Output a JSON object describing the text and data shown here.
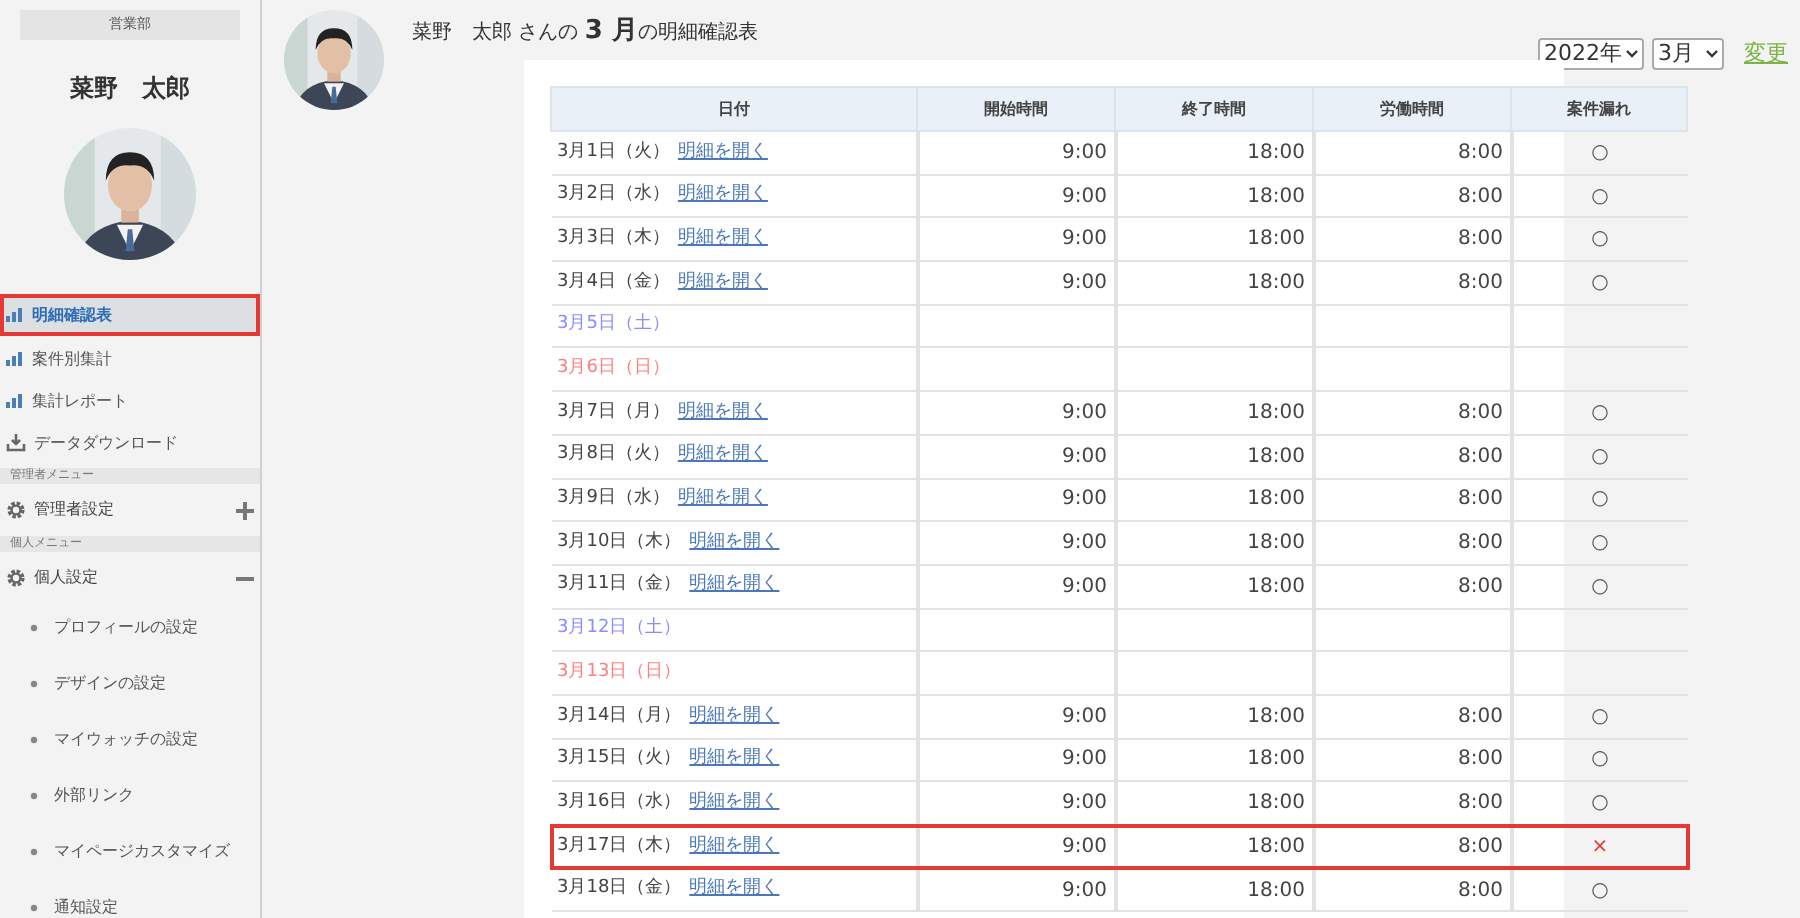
{
  "sidebar": {
    "department": "営業部",
    "user_name": "菜野　太郎",
    "menu": [
      {
        "kind": "report",
        "label": "明細確認表",
        "selected": true
      },
      {
        "kind": "report",
        "label": "案件別集計",
        "selected": false
      },
      {
        "kind": "report",
        "label": "集計レポート",
        "selected": false
      },
      {
        "kind": "download",
        "label": "データダウンロード",
        "selected": false
      },
      {
        "kind": "section",
        "label": "管理者メニュー"
      },
      {
        "kind": "group",
        "label": "管理者設定",
        "expanded": false
      },
      {
        "kind": "section",
        "label": "個人メニュー"
      },
      {
        "kind": "group",
        "label": "個人設定",
        "expanded": true,
        "children": [
          {
            "label": "プロフィールの設定"
          },
          {
            "label": "デザインの設定"
          },
          {
            "label": "マイウォッチの設定"
          },
          {
            "label": "外部リンク"
          },
          {
            "label": "マイページカスタマイズ"
          },
          {
            "label": "通知設定"
          }
        ]
      }
    ]
  },
  "header": {
    "title": "菜野　太郎 さんの **3 月**の明細確認表"
  },
  "period": {
    "year": "2022年",
    "month": "3月",
    "change_link": "変更"
  },
  "table": {
    "columns": [
      "日付",
      "開始時間",
      "終了時間",
      "労働時間",
      "案件漏れ"
    ],
    "rows": [
      {
        "kind": "workday",
        "date": "3月1日（火）",
        "link": "明細を開く",
        "start": "9:00",
        "end": "18:00",
        "hours": "8:00",
        "mark": "○",
        "alert": false
      },
      {
        "kind": "workday",
        "date": "3月2日（水）",
        "link": "明細を開く",
        "start": "9:00",
        "end": "18:00",
        "hours": "8:00",
        "mark": "○",
        "alert": false
      },
      {
        "kind": "workday",
        "date": "3月3日（木）",
        "link": "明細を開く",
        "start": "9:00",
        "end": "18:00",
        "hours": "8:00",
        "mark": "○",
        "alert": false
      },
      {
        "kind": "workday",
        "date": "3月4日（金）",
        "link": "明細を開く",
        "start": "9:00",
        "end": "18:00",
        "hours": "8:00",
        "mark": "○",
        "alert": false
      },
      {
        "kind": "saturday",
        "date": "3月5日（土）"
      },
      {
        "kind": "sunday",
        "date": "3月6日（日）"
      },
      {
        "kind": "workday",
        "date": "3月7日（月）",
        "link": "明細を開く",
        "start": "9:00",
        "end": "18:00",
        "hours": "8:00",
        "mark": "○",
        "alert": false
      },
      {
        "kind": "workday",
        "date": "3月8日（火）",
        "link": "明細を開く",
        "start": "9:00",
        "end": "18:00",
        "hours": "8:00",
        "mark": "○",
        "alert": false
      },
      {
        "kind": "workday",
        "date": "3月9日（水）",
        "link": "明細を開く",
        "start": "9:00",
        "end": "18:00",
        "hours": "8:00",
        "mark": "○",
        "alert": false
      },
      {
        "kind": "workday",
        "date": "3月10日（木）",
        "link": "明細を開く",
        "start": "9:00",
        "end": "18:00",
        "hours": "8:00",
        "mark": "○",
        "alert": false
      },
      {
        "kind": "workday",
        "date": "3月11日（金）",
        "link": "明細を開く",
        "start": "9:00",
        "end": "18:00",
        "hours": "8:00",
        "mark": "○",
        "alert": false
      },
      {
        "kind": "saturday",
        "date": "3月12日（土）"
      },
      {
        "kind": "sunday",
        "date": "3月13日（日）"
      },
      {
        "kind": "workday",
        "date": "3月14日（月）",
        "link": "明細を開く",
        "start": "9:00",
        "end": "18:00",
        "hours": "8:00",
        "mark": "○",
        "alert": false
      },
      {
        "kind": "workday",
        "date": "3月15日（火）",
        "link": "明細を開く",
        "start": "9:00",
        "end": "18:00",
        "hours": "8:00",
        "mark": "○",
        "alert": false
      },
      {
        "kind": "workday",
        "date": "3月16日（水）",
        "link": "明細を開く",
        "start": "9:00",
        "end": "18:00",
        "hours": "8:00",
        "mark": "○",
        "alert": false
      },
      {
        "kind": "workday",
        "date": "3月17日（木）",
        "link": "明細を開く",
        "start": "9:00",
        "end": "18:00",
        "hours": "8:00",
        "mark": "×",
        "alert": true
      },
      {
        "kind": "workday",
        "date": "3月18日（金）",
        "link": "明細を開く",
        "start": "9:00",
        "end": "18:00",
        "hours": "8:00",
        "mark": "○",
        "alert": false
      }
    ]
  }
}
